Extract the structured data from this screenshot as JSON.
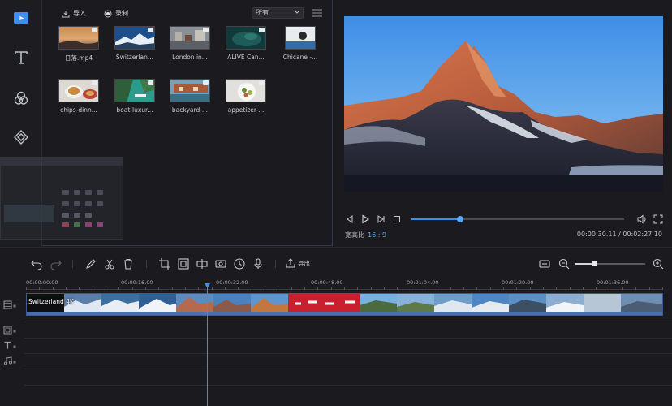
{
  "colors": {
    "accent": "#3d8ef0",
    "panel": "#1b1b1f",
    "clip_red": "#c8202f"
  },
  "rail": {
    "items": [
      {
        "id": "media",
        "icon": "media-play-icon"
      },
      {
        "id": "text",
        "icon": "text-icon"
      },
      {
        "id": "filters",
        "icon": "filters-icon"
      },
      {
        "id": "overlays",
        "icon": "overlay-icon"
      }
    ]
  },
  "media": {
    "import_label": "导入",
    "record_label": "录制",
    "filter_value": "所有",
    "items": [
      {
        "label": "日落.mp4"
      },
      {
        "label": "Switzerlan..."
      },
      {
        "label": "London in..."
      },
      {
        "label": "ALIVE  Can..."
      },
      {
        "label": "Chicane -..."
      },
      {
        "label": "chips-dinn..."
      },
      {
        "label": "boat-luxur..."
      },
      {
        "label": "backyard-..."
      },
      {
        "label": "appetizer-..."
      }
    ]
  },
  "preview": {
    "ratio_label": "宽高比",
    "ratio_value": "16 : 9",
    "time": "00:00:30.11 / 00:02:27.10",
    "progress": 0.23
  },
  "toolbar": {
    "export_label": "导出",
    "zoom": 0.27
  },
  "timeline": {
    "ruler": [
      "00:00:00.00",
      "00:00:16.00",
      "00:00:32.00",
      "00:00:48.00",
      "00:01:04.00",
      "00:01:20.00",
      "00:01:36.00"
    ],
    "clip_title": "Switzerland 4K"
  }
}
